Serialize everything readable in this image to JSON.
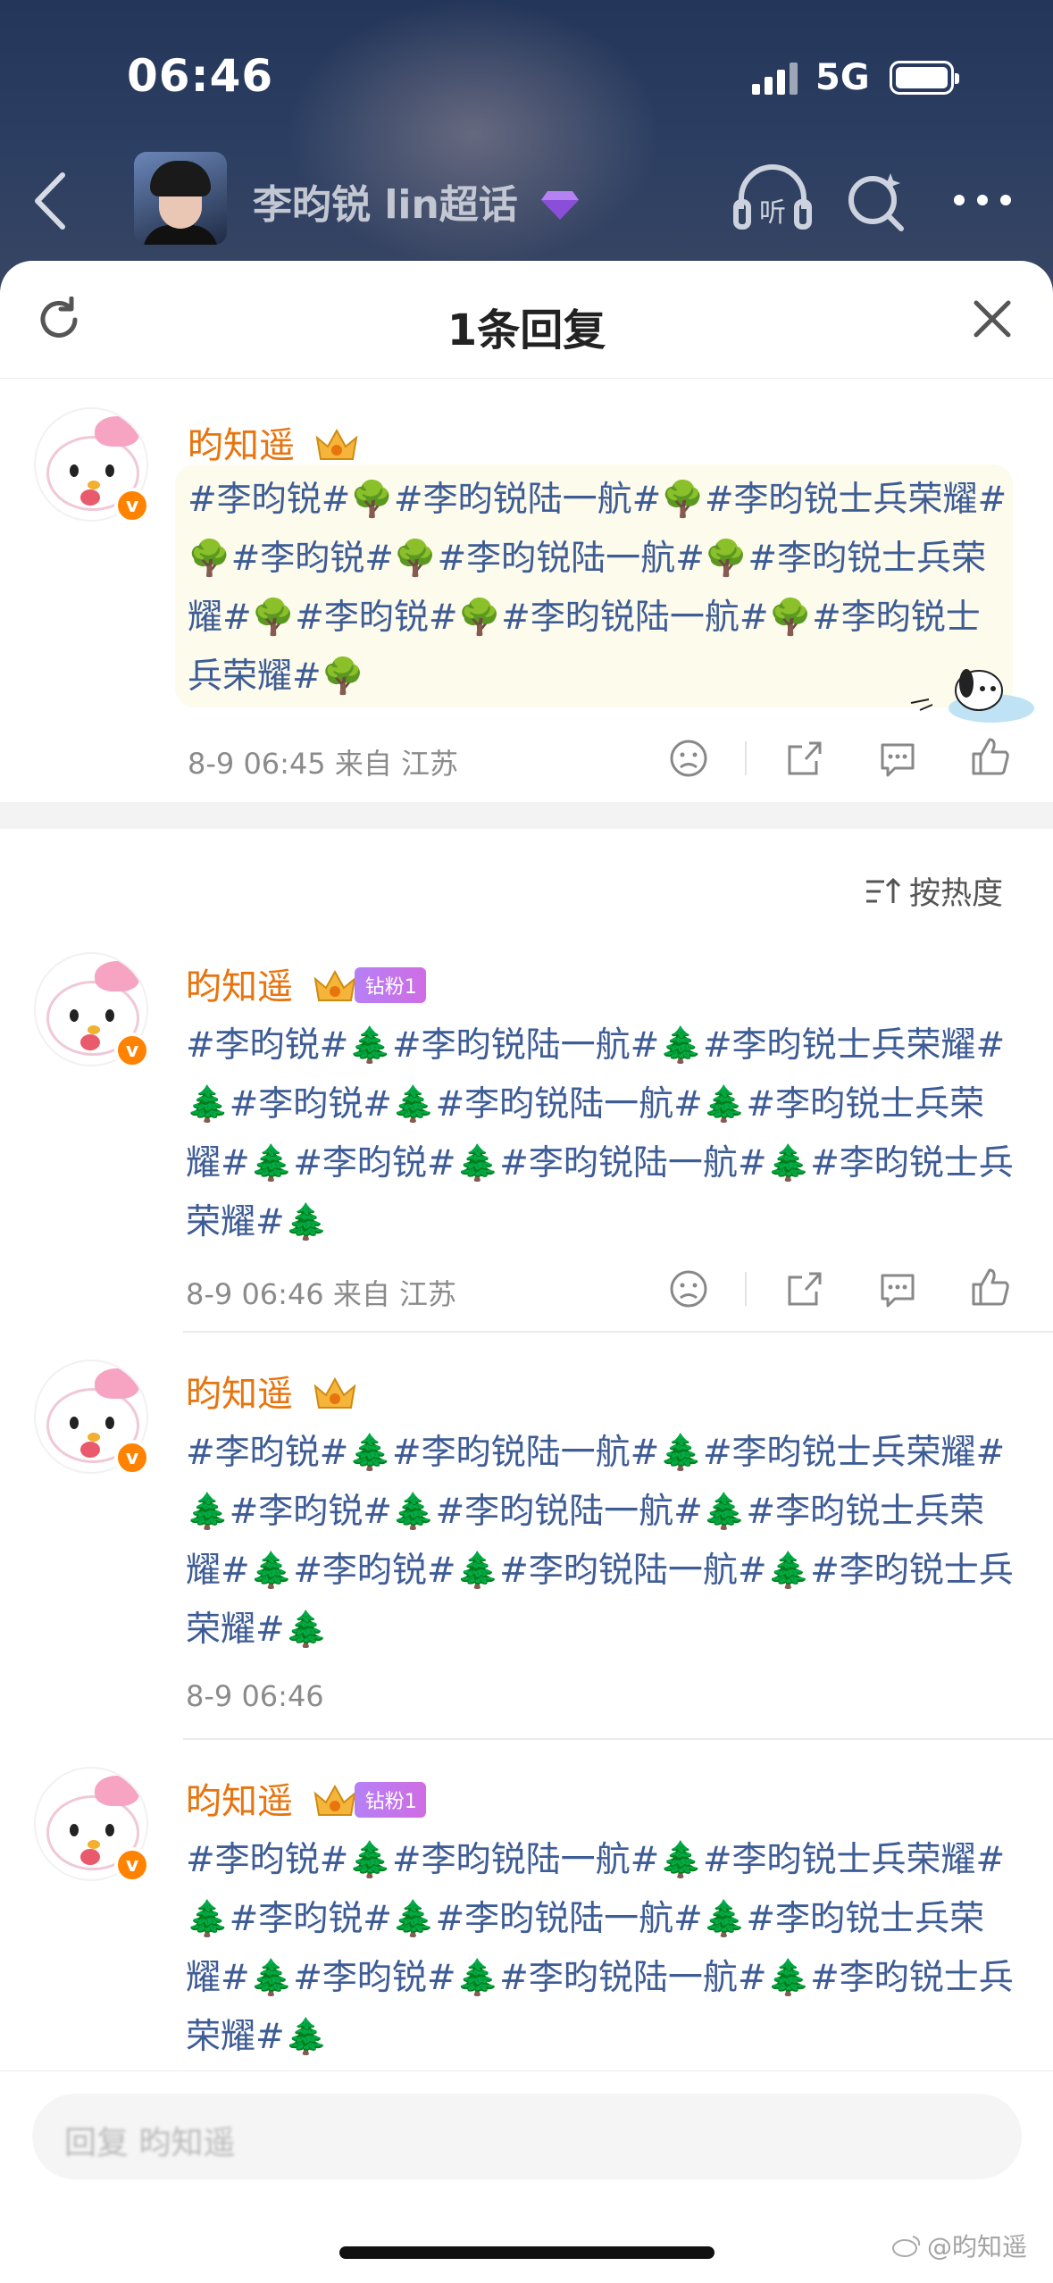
{
  "status": {
    "time": "06:46",
    "network": "5G"
  },
  "nav": {
    "title": "李昀锐 lin超话",
    "back_icon": "chevron-left-icon",
    "listen_icon": "headphones-icon",
    "listen_label": "听",
    "search_icon": "search-sparkle-icon",
    "more_icon": "more-dots-icon"
  },
  "sheet": {
    "title": "1条回复",
    "refresh_icon": "refresh-icon",
    "close_icon": "close-icon"
  },
  "root_comment": {
    "username": "昀知遥",
    "text_html": "#李昀锐#<span class='tree'>🌳</span>#李昀锐陆一航#<span class='tree'>🌳</span>#李昀锐士兵荣耀#<span class='tree'>🌳</span>#李昀锐#<span class='tree'>🌳</span>#李昀锐陆一航#<span class='tree'>🌳</span>#李昀锐士兵荣耀#<span class='tree'>🌳</span>#李昀锐#<span class='tree'>🌳</span>#李昀锐陆一航#<span class='tree'>🌳</span>#李昀锐士兵荣耀#<span class='tree'>🌳</span>",
    "meta": "8-9 06:45  来自 江苏"
  },
  "sort": {
    "label": "按热度"
  },
  "replies": [
    {
      "username": "昀知遥",
      "fan_badge": "钻粉1",
      "meta": "8-9 06:46  来自 江苏"
    },
    {
      "username": "昀知遥",
      "fan_badge": "",
      "meta": "8-9 06:46"
    },
    {
      "username": "昀知遥",
      "fan_badge": "钻粉1",
      "meta": ""
    }
  ],
  "reply_text_html": "#李昀锐#<span class='tree'>🌲</span>#李昀锐陆一航#<span class='tree'>🌲</span>#李昀锐士兵荣耀#<span class='tree'>🌲</span>#李昀锐#<span class='tree'>🌲</span>#李昀锐陆一航#<span class='tree'>🌲</span>#李昀锐士兵荣耀#<span class='tree'>🌲</span>#李昀锐#<span class='tree'>🌲</span>#李昀锐陆一航#<span class='tree'>🌲</span>#李昀锐士兵荣耀#<span class='tree'>🌲</span>",
  "input": {
    "placeholder": "回复 昀知遥"
  },
  "watermark": "@昀知遥",
  "colors": {
    "accent_orange": "#e8740e",
    "topic_blue": "#3e5c95",
    "verified": "#ff8200"
  }
}
